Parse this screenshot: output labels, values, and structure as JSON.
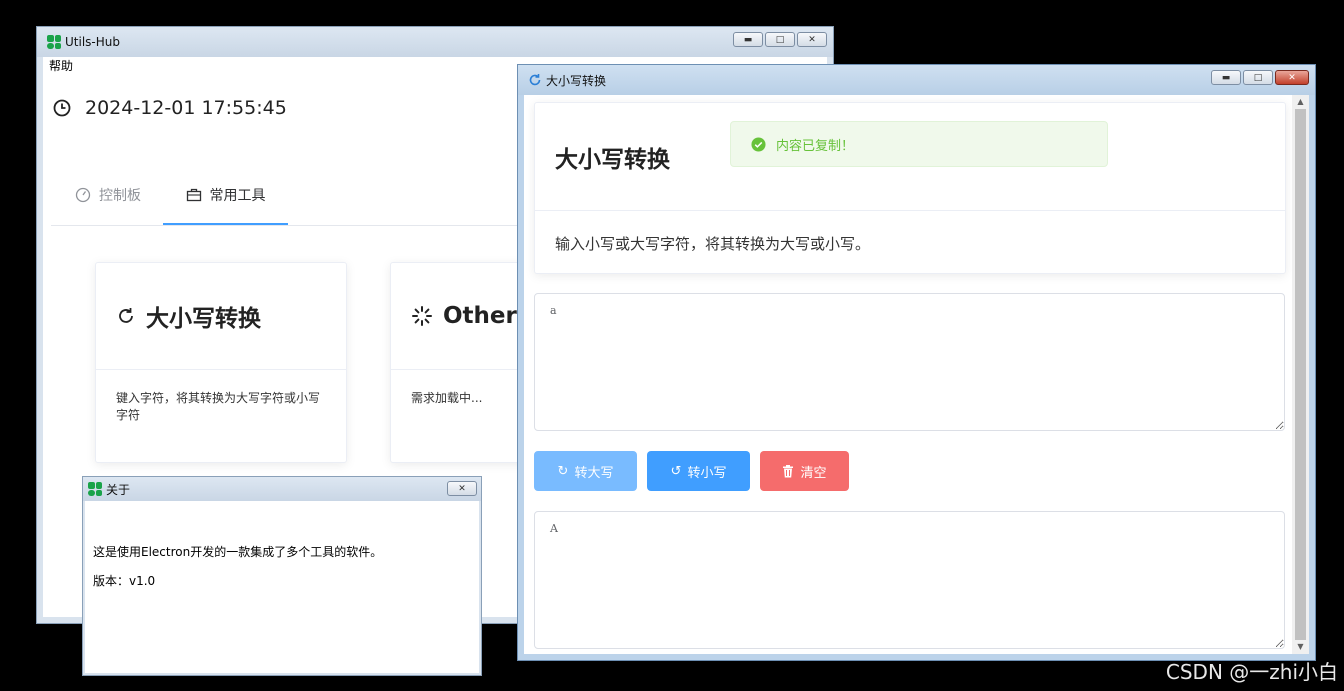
{
  "main_window": {
    "title": "Utils-Hub",
    "menu": [
      "帮助"
    ],
    "datetime": "2024-12-01 17:55:45",
    "tabs": [
      {
        "label": "控制板",
        "icon": "dashboard-icon",
        "active": false
      },
      {
        "label": "常用工具",
        "icon": "briefcase-icon",
        "active": true
      }
    ],
    "cards": [
      {
        "title": "大小写转换",
        "icon": "refresh-icon",
        "description": "键入字符，将其转换为大写字符或小写字符"
      },
      {
        "title": "Other",
        "icon": "loading-icon",
        "description": "需求加载中..."
      }
    ]
  },
  "about_dialog": {
    "title": "关于",
    "text": "这是使用Electron开发的一款集成了多个工具的软件。",
    "version": "版本：v1.0"
  },
  "converter_window": {
    "title": "大小写转换",
    "header_title": "大小写转换",
    "toast": "内容已复制！",
    "description": "输入小写或大写字符，将其转换为大写或小写。",
    "input_value": "a",
    "output_value": "A",
    "buttons": {
      "upper": "转大写",
      "lower": "转小写",
      "clear": "清空"
    },
    "colors": {
      "primary": "#409eff",
      "primary_light": "#79bbff",
      "danger": "#f56c6c",
      "success": "#67c23a"
    }
  },
  "watermark": "CSDN @一zhi小白"
}
